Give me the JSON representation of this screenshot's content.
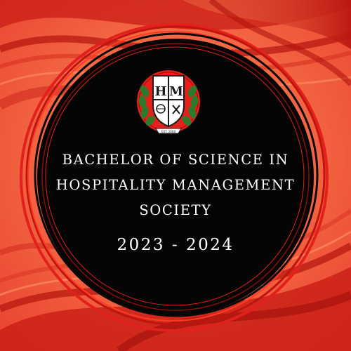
{
  "colors": {
    "background": "#f46a45",
    "wave": "#d8261c",
    "disc": "#050505",
    "ring": "#e3201b",
    "text": "#ffffff",
    "emblem_green": "#2d7a2a"
  },
  "emblem": {
    "monogram_left": "H",
    "monogram_right": "M",
    "ribbon": "EST. 2008"
  },
  "title": {
    "line1": "BACHELOR OF SCIENCE IN",
    "line2": "HOSPITALITY MANAGEMENT",
    "line3": "SOCIETY"
  },
  "years": "2023 - 2024"
}
